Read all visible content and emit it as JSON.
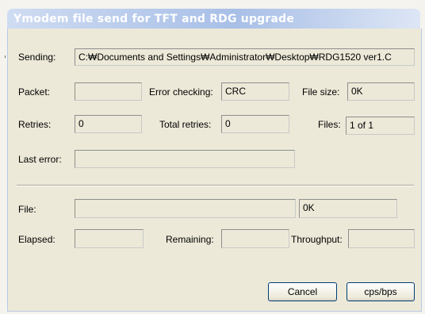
{
  "window": {
    "title": "Ymodem file send for TFT and RDG upgrade"
  },
  "labels": {
    "sending": "Sending:",
    "packet": "Packet:",
    "error_checking": "Error checking:",
    "file_size": "File size:",
    "retries": "Retries:",
    "total_retries": "Total retries:",
    "files": "Files:",
    "last_error": "Last error:",
    "file": "File:",
    "elapsed": "Elapsed:",
    "remaining": "Remaining:",
    "throughput": "Throughput:"
  },
  "values": {
    "sending": "C:₩Documents and Settings₩Administrator₩Desktop₩RDG1520 ver1.C",
    "packet": "",
    "error_checking": "CRC",
    "file_size": "0K",
    "retries": "0",
    "total_retries": "0",
    "files": "1 of 1",
    "last_error": "",
    "file_progress": "",
    "file_bytes": "0K",
    "elapsed": "",
    "remaining": "",
    "throughput": ""
  },
  "progress": {
    "fraction": 0
  },
  "buttons": {
    "cancel": "Cancel",
    "cps": "cps/bps"
  }
}
